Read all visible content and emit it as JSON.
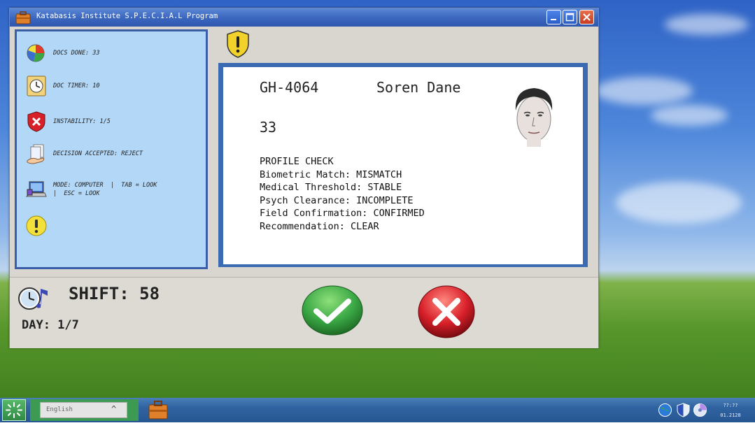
{
  "window": {
    "title": "Katabasis Institute S.P.E.C.I.A.L Program"
  },
  "sidebar": {
    "items": [
      {
        "label": "DOCS DONE: 33",
        "icon": "pie-chart-icon"
      },
      {
        "label": "DOC TIMER: 10",
        "icon": "clock-icon"
      },
      {
        "label": "INSTABILITY: 1/5",
        "icon": "shield-x-icon"
      },
      {
        "label": "DECISION ACCEPTED: REJECT",
        "icon": "hand-document-icon"
      },
      {
        "label": "MODE: COMPUTER  |  TAB = LOOK\n|  ESC = LOOK",
        "icon": "computer-icon"
      },
      {
        "label": "",
        "icon": "exclamation-icon"
      }
    ]
  },
  "document": {
    "id": "GH-4064",
    "name": "Soren Dane",
    "age": "33",
    "lines": [
      "PROFILE CHECK",
      "Biometric Match: MISMATCH",
      "Medical Threshold: STABLE",
      "Psych Clearance: INCOMPLETE",
      "Field Confirmation: CONFIRMED",
      "Recommendation: CLEAR"
    ]
  },
  "status": {
    "shift": "SHIFT: 58",
    "day": "DAY: 1/7"
  },
  "taskbar": {
    "language": "English",
    "time": "??:??",
    "date": "01.2128"
  },
  "colors": {
    "titlebar": "#3d68c0",
    "sidebar_bg": "#b3d7f6",
    "sidebar_border": "#3a5fa8",
    "doc_frame": "#3a6bb3",
    "accept": "#3aa845",
    "reject": "#d8202a"
  }
}
